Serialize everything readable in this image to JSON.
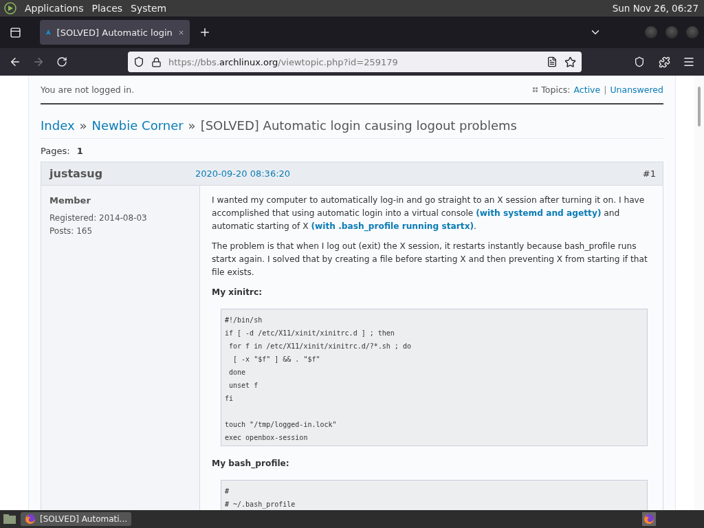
{
  "desktop_panel": {
    "menus": [
      "Applications",
      "Places",
      "System"
    ],
    "clock": "Sun Nov 26, 06:27"
  },
  "browser": {
    "tabs": [
      {
        "title": "[SOLVED] Automatic login",
        "selected": true
      }
    ],
    "nav": {
      "forward_disabled": true
    },
    "url": {
      "scheme": "https://bbs.",
      "domain": "archlinux.org",
      "path": "/viewtopic.php?id=259179"
    }
  },
  "page": {
    "login_status": "You are not logged in.",
    "topics_label": "Topics:",
    "topic_links": [
      {
        "label": "Active"
      },
      {
        "sep": "|",
        "label": "Unanswered"
      }
    ],
    "breadcrumb": [
      {
        "label": "Index",
        "kind": "link"
      },
      {
        "sep": "»",
        "label": "Newbie Corner",
        "kind": "link"
      },
      {
        "sep": "»",
        "label": "[SOLVED] Automatic login causing logout problems",
        "kind": "current"
      }
    ],
    "pages_label": "Pages:",
    "pages": [
      {
        "label": "1",
        "selected": true
      }
    ],
    "post": {
      "author": "justasug",
      "date": "2020-09-20 08:36:20",
      "number": "#1",
      "rank": "Member",
      "registered": "Registered: 2014-08-03",
      "posts": "Posts: 165",
      "body": [
        {
          "kind": "paragraph",
          "segments": [
            {
              "text": "I wanted my computer to automatically log-in and go straight to an X session after turning it on. I have accomplished that using automatic login into a virtual console ",
              "kind": "text"
            },
            {
              "text": "(with systemd and agetty)",
              "kind": "link"
            },
            {
              "text": " and automatic starting of X ",
              "kind": "text"
            },
            {
              "text": "(with .bash_profile running startx)",
              "kind": "link"
            },
            {
              "text": ".",
              "kind": "text"
            }
          ]
        },
        {
          "kind": "paragraph",
          "segments": [
            {
              "text": "The problem is that when I log out (exit) the X session, it restarts instantly because bash_profile runs startx again. I solved that by creating a file before starting X and then preventing X from starting if that file exists.",
              "kind": "text"
            }
          ]
        },
        {
          "kind": "heading",
          "text": "My xinitrc:"
        },
        {
          "kind": "code",
          "text": "#!/bin/sh\nif [ -d /etc/X11/xinit/xinitrc.d ] ; then\n for f in /etc/X11/xinit/xinitrc.d/?*.sh ; do\n  [ -x \"$f\" ] && . \"$f\"\n done\n unset f\nfi\n\ntouch \"/tmp/logged-in.lock\"\nexec openbox-session"
        },
        {
          "kind": "heading",
          "text": "My bash_profile:"
        },
        {
          "kind": "code",
          "text": "#\n# ~/.bash_profile"
        }
      ]
    }
  },
  "taskbar": {
    "windows": [
      {
        "title": "[SOLVED] Automati...",
        "selected": true
      }
    ]
  }
}
